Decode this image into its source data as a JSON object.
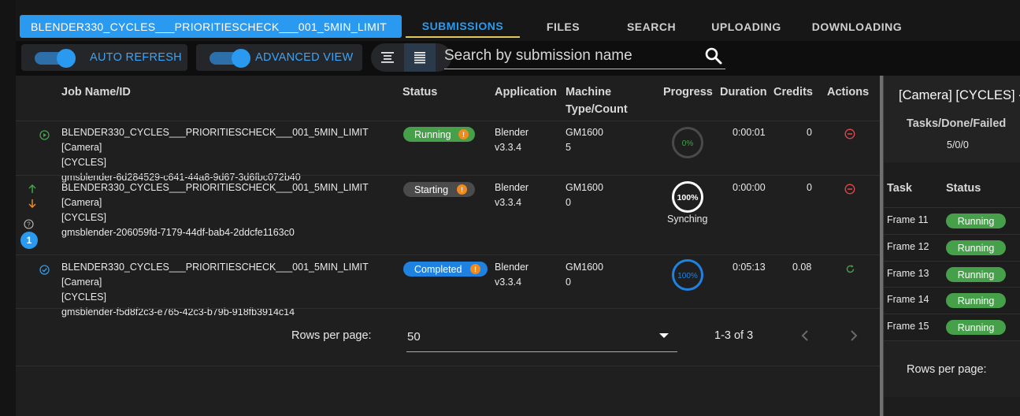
{
  "project_name": "BLENDER330_CYCLES___PRIORITIESCHECK___001_5MIN_LIMIT",
  "tabs": [
    {
      "label": "SUBMISSIONS",
      "active": true
    },
    {
      "label": "FILES",
      "active": false
    },
    {
      "label": "SEARCH",
      "active": false
    },
    {
      "label": "UPLOADING",
      "active": false
    },
    {
      "label": "DOWNLOADING",
      "active": false
    }
  ],
  "toolbar": {
    "auto_refresh_label": "AUTO REFRESH",
    "auto_refresh_on": true,
    "advanced_view_label": "ADVANCED VIEW",
    "advanced_view_on": true,
    "search_placeholder": "Search by submission name",
    "search_value": ""
  },
  "table": {
    "headers": {
      "job": "Job Name/ID",
      "status": "Status",
      "application": "Application",
      "machine_line1": "Machine",
      "machine_line2": "Type/Count",
      "progress": "Progress",
      "duration": "Duration",
      "credits": "Credits",
      "actions": "Actions"
    },
    "rows": [
      {
        "row_icon": "play-circle-icon",
        "name_line1": "BLENDER330_CYCLES___PRIORITIESCHECK___001_5MIN_LIMIT [Camera]",
        "name_line2": "[CYCLES]",
        "job_id": "gmsblender-6d284529-c641-44a8-9d67-3d6fbc072b40",
        "status": "Running",
        "app_name": "Blender",
        "app_version": "v3.3.4",
        "machine_type": "GM1600",
        "machine_count": "5",
        "progress_pct": 0,
        "progress_text": "0%",
        "progress_note": "",
        "duration": "0:00:01",
        "credits": "0",
        "action_icon": "cancel-icon"
      },
      {
        "row_icon": "priority-arrows-icon",
        "name_line1": "BLENDER330_CYCLES___PRIORITIESCHECK___001_5MIN_LIMIT [Camera]",
        "name_line2": "[CYCLES]",
        "job_id": "gmsblender-206059fd-7179-44df-bab4-2ddcfe1163c0",
        "status": "Starting",
        "queue_badge": "1",
        "app_name": "Blender",
        "app_version": "v3.3.4",
        "machine_type": "GM1600",
        "machine_count": "0",
        "progress_pct": 100,
        "progress_text": "100%",
        "progress_note": "Synching",
        "duration": "0:00:00",
        "credits": "0",
        "action_icon": "cancel-icon"
      },
      {
        "row_icon": "check-circle-icon",
        "name_line1": "BLENDER330_CYCLES___PRIORITIESCHECK___001_5MIN_LIMIT [Camera]",
        "name_line2": "[CYCLES]",
        "job_id": "gmsblender-f5d8f2c3-e765-42c3-b79b-918fb3914c14",
        "status": "Completed",
        "app_name": "Blender",
        "app_version": "v3.3.4",
        "machine_type": "GM1600",
        "machine_count": "0",
        "progress_pct": 100,
        "progress_text": "100%",
        "progress_note": "",
        "duration": "0:05:13",
        "credits": "0.08",
        "action_icon": "retry-icon"
      }
    ],
    "pager": {
      "rows_per_page_label": "Rows per page:",
      "rows_per_page_value": "50",
      "range_text": "1-3 of 3"
    }
  },
  "panel": {
    "title": "[Camera] [CYCLES] -",
    "tasks_label": "Tasks/Done/Failed",
    "tasks_counts": "5/0/0",
    "col_task": "Task",
    "col_status": "Status",
    "tasks": [
      {
        "frame": "Frame 11",
        "status": "Running"
      },
      {
        "frame": "Frame 12",
        "status": "Running"
      },
      {
        "frame": "Frame 13",
        "status": "Running"
      },
      {
        "frame": "Frame 14",
        "status": "Running"
      },
      {
        "frame": "Frame 15",
        "status": "Running"
      }
    ],
    "rows_per_page_label": "Rows per page:"
  },
  "colors": {
    "accent": "#2a9af0",
    "running": "#46a04a",
    "starting": "#4b4b4b",
    "completed": "#1f82e0",
    "warning": "#ef8a1f",
    "danger": "#e54848"
  }
}
